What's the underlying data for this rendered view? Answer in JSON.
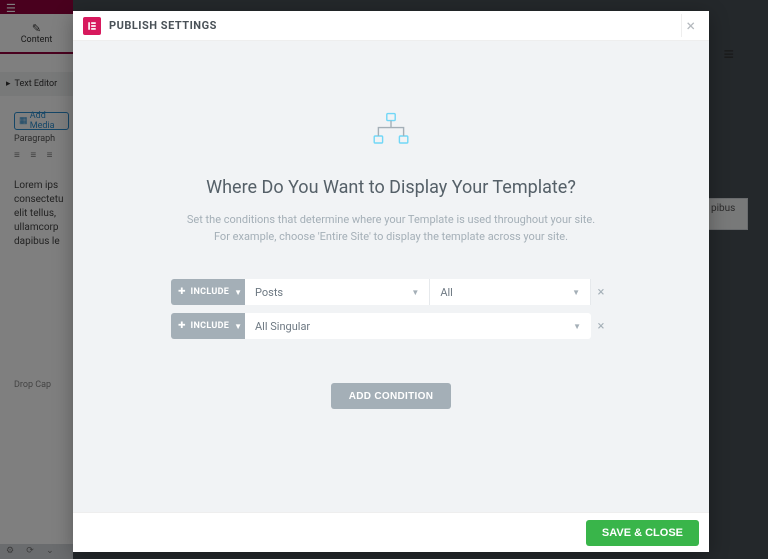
{
  "background": {
    "content_tab": "Content",
    "panel_item": "Text Editor",
    "add_media": "Add Media",
    "paragraph_label": "Paragraph",
    "lorem_lines": [
      "Lorem ips",
      "consectetu",
      "elit tellus,",
      "ullamcorp",
      "dapibus le"
    ],
    "drop_cap": "Drop Cap",
    "right_cell": "pibus"
  },
  "modal": {
    "title": "PUBLISH SETTINGS",
    "heading": "Where Do You Want to Display Your Template?",
    "sub1": "Set the conditions that determine where your Template is used throughout your site.",
    "sub2": "For example, choose 'Entire Site' to display the template across your site.",
    "include_label": "INCLUDE",
    "rows": [
      {
        "sel1": "Posts",
        "sel2": "All"
      },
      {
        "sel1": "All Singular"
      }
    ],
    "add_label": "ADD CONDITION",
    "save_label": "SAVE & CLOSE"
  }
}
